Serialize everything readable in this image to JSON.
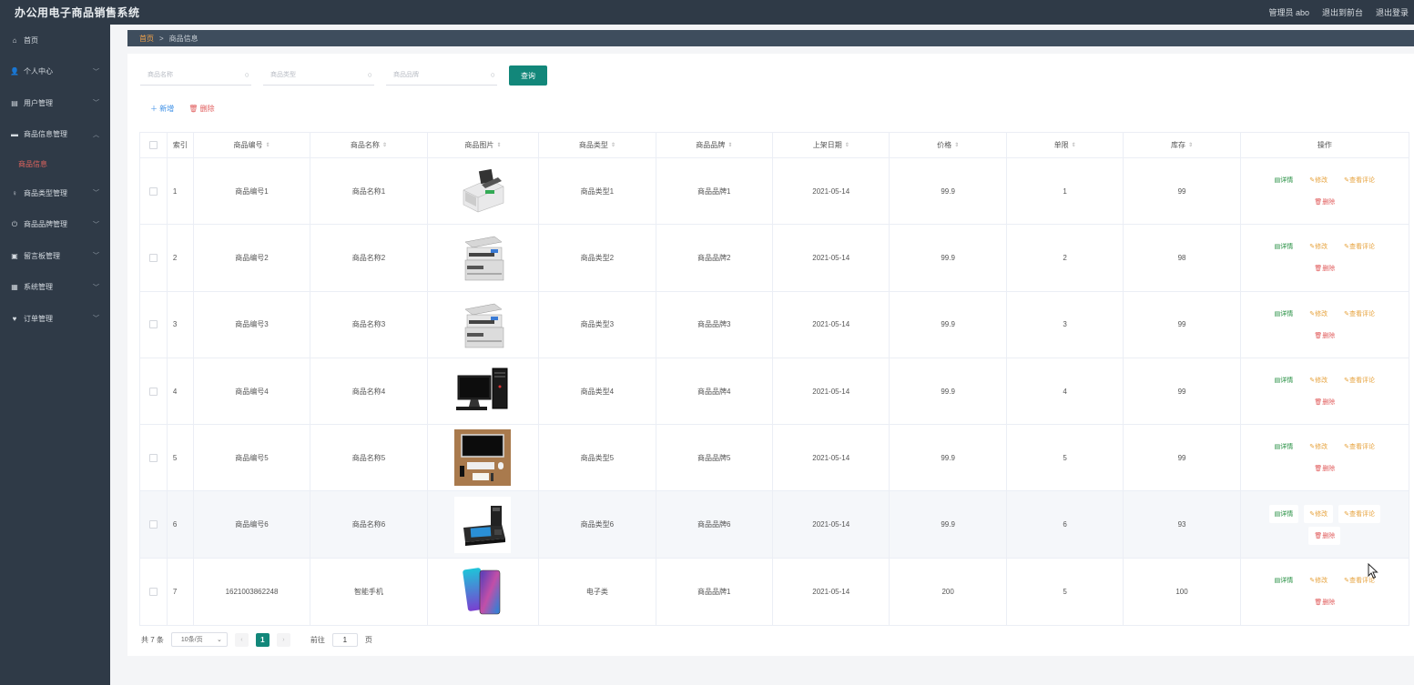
{
  "app": {
    "title": "办公用电子商品销售系统"
  },
  "header": {
    "user": "管理员 abo",
    "to_frontend": "退出到前台",
    "logout": "退出登录"
  },
  "sidebar": {
    "items": [
      {
        "label": "首页",
        "icon": "home-icon",
        "glyph": "⌂",
        "expandable": false
      },
      {
        "label": "个人中心",
        "icon": "user-icon",
        "glyph": "👤",
        "expandable": true
      },
      {
        "label": "用户管理",
        "icon": "clipboard-icon",
        "glyph": "▤",
        "expandable": true
      },
      {
        "label": "商品信息管理",
        "icon": "printer-icon",
        "glyph": "▬",
        "expandable": true,
        "expanded": true
      },
      {
        "label": "商品类型管理",
        "icon": "bulb-icon",
        "glyph": "♀",
        "expandable": true
      },
      {
        "label": "商品品牌管理",
        "icon": "power-icon",
        "glyph": "⏻",
        "expandable": true
      },
      {
        "label": "留言板管理",
        "icon": "board-icon",
        "glyph": "▣",
        "expandable": true
      },
      {
        "label": "系统管理",
        "icon": "grid-icon",
        "glyph": "▦",
        "expandable": true
      },
      {
        "label": "订单管理",
        "icon": "trophy-icon",
        "glyph": "♥",
        "expandable": true
      }
    ],
    "active_sub": "商品信息"
  },
  "breadcrumb": {
    "home": "首页",
    "sep": ">",
    "current": "商品信息"
  },
  "search": {
    "name_placeholder": "商品名称",
    "type_placeholder": "商品类型",
    "brand_placeholder": "商品品牌",
    "query_label": "查询"
  },
  "actions": {
    "add": "新增",
    "delete": "删除"
  },
  "table": {
    "headers": {
      "index": "索引",
      "code": "商品编号",
      "name": "商品名称",
      "image": "商品图片",
      "type": "商品类型",
      "brand": "商品品牌",
      "date": "上架日期",
      "price": "价格",
      "limit": "单限",
      "stock": "库存",
      "ops": "操作"
    },
    "rows": [
      {
        "index": "1",
        "code": "商品编号1",
        "name": "商品名称1",
        "image": "money-counter",
        "type": "商品类型1",
        "brand": "商品品牌1",
        "date": "2021-05-14",
        "price": "99.9",
        "limit": "1",
        "stock": "99"
      },
      {
        "index": "2",
        "code": "商品编号2",
        "name": "商品名称2",
        "image": "copier",
        "type": "商品类型2",
        "brand": "商品品牌2",
        "date": "2021-05-14",
        "price": "99.9",
        "limit": "2",
        "stock": "98"
      },
      {
        "index": "3",
        "code": "商品编号3",
        "name": "商品名称3",
        "image": "copier",
        "type": "商品类型3",
        "brand": "商品品牌3",
        "date": "2021-05-14",
        "price": "99.9",
        "limit": "3",
        "stock": "99"
      },
      {
        "index": "4",
        "code": "商品编号4",
        "name": "商品名称4",
        "image": "desktop-computer",
        "type": "商品类型4",
        "brand": "商品品牌4",
        "date": "2021-05-14",
        "price": "99.9",
        "limit": "4",
        "stock": "99"
      },
      {
        "index": "5",
        "code": "商品编号5",
        "name": "商品名称5",
        "image": "imac-desk",
        "type": "商品类型5",
        "brand": "商品品牌5",
        "date": "2021-05-14",
        "price": "99.9",
        "limit": "5",
        "stock": "99"
      },
      {
        "index": "6",
        "code": "商品编号6",
        "name": "商品名称6",
        "image": "pos-terminal",
        "type": "商品类型6",
        "brand": "商品品牌6",
        "date": "2021-05-14",
        "price": "99.9",
        "limit": "6",
        "stock": "93",
        "highlight": true
      },
      {
        "index": "7",
        "code": "1621003862248",
        "name": "智能手机",
        "image": "smartphone",
        "type": "电子类",
        "brand": "商品品牌1",
        "date": "2021-05-14",
        "price": "200",
        "limit": "5",
        "stock": "100"
      }
    ],
    "ops": {
      "detail": "详情",
      "edit": "修改",
      "review": "查看评论",
      "delete": "删除"
    }
  },
  "pager": {
    "total": "共 7 条",
    "page_size": "10条/页",
    "current_page": "1",
    "goto_prefix": "前往",
    "goto_value": "1",
    "goto_suffix": "页"
  },
  "colors": {
    "sidebar_bg": "#2f3a47",
    "crumb_bg": "#3e4d5d",
    "primary": "#12877a",
    "danger": "#e05b5b",
    "warning": "#e6a23c",
    "success": "#1e8c3b",
    "active_menu": "#e0645e"
  }
}
